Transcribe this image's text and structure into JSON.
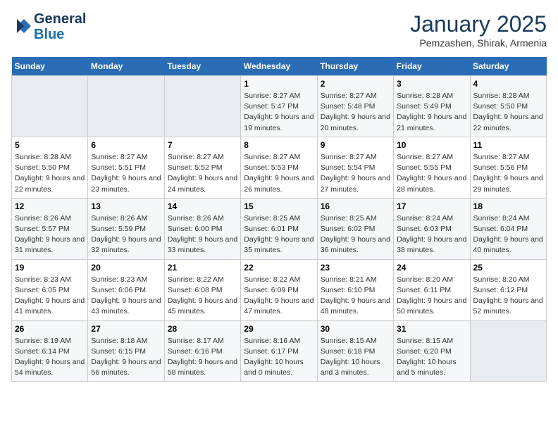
{
  "header": {
    "logo_line1": "General",
    "logo_line2": "Blue",
    "month": "January 2025",
    "location": "Pemzashen, Shirak, Armenia"
  },
  "weekdays": [
    "Sunday",
    "Monday",
    "Tuesday",
    "Wednesday",
    "Thursday",
    "Friday",
    "Saturday"
  ],
  "weeks": [
    [
      {
        "day": "",
        "empty": true
      },
      {
        "day": "",
        "empty": true
      },
      {
        "day": "",
        "empty": true
      },
      {
        "day": "1",
        "sunrise": "8:27 AM",
        "sunset": "5:47 PM",
        "daylight": "9 hours and 19 minutes."
      },
      {
        "day": "2",
        "sunrise": "8:27 AM",
        "sunset": "5:48 PM",
        "daylight": "9 hours and 20 minutes."
      },
      {
        "day": "3",
        "sunrise": "8:28 AM",
        "sunset": "5:49 PM",
        "daylight": "9 hours and 21 minutes."
      },
      {
        "day": "4",
        "sunrise": "8:28 AM",
        "sunset": "5:50 PM",
        "daylight": "9 hours and 22 minutes."
      }
    ],
    [
      {
        "day": "5",
        "sunrise": "8:28 AM",
        "sunset": "5:50 PM",
        "daylight": "9 hours and 22 minutes."
      },
      {
        "day": "6",
        "sunrise": "8:27 AM",
        "sunset": "5:51 PM",
        "daylight": "9 hours and 23 minutes."
      },
      {
        "day": "7",
        "sunrise": "8:27 AM",
        "sunset": "5:52 PM",
        "daylight": "9 hours and 24 minutes."
      },
      {
        "day": "8",
        "sunrise": "8:27 AM",
        "sunset": "5:53 PM",
        "daylight": "9 hours and 26 minutes."
      },
      {
        "day": "9",
        "sunrise": "8:27 AM",
        "sunset": "5:54 PM",
        "daylight": "9 hours and 27 minutes."
      },
      {
        "day": "10",
        "sunrise": "8:27 AM",
        "sunset": "5:55 PM",
        "daylight": "9 hours and 28 minutes."
      },
      {
        "day": "11",
        "sunrise": "8:27 AM",
        "sunset": "5:56 PM",
        "daylight": "9 hours and 29 minutes."
      }
    ],
    [
      {
        "day": "12",
        "sunrise": "8:26 AM",
        "sunset": "5:57 PM",
        "daylight": "9 hours and 31 minutes."
      },
      {
        "day": "13",
        "sunrise": "8:26 AM",
        "sunset": "5:59 PM",
        "daylight": "9 hours and 32 minutes."
      },
      {
        "day": "14",
        "sunrise": "8:26 AM",
        "sunset": "6:00 PM",
        "daylight": "9 hours and 33 minutes."
      },
      {
        "day": "15",
        "sunrise": "8:25 AM",
        "sunset": "6:01 PM",
        "daylight": "9 hours and 35 minutes."
      },
      {
        "day": "16",
        "sunrise": "8:25 AM",
        "sunset": "6:02 PM",
        "daylight": "9 hours and 36 minutes."
      },
      {
        "day": "17",
        "sunrise": "8:24 AM",
        "sunset": "6:03 PM",
        "daylight": "9 hours and 38 minutes."
      },
      {
        "day": "18",
        "sunrise": "8:24 AM",
        "sunset": "6:04 PM",
        "daylight": "9 hours and 40 minutes."
      }
    ],
    [
      {
        "day": "19",
        "sunrise": "8:23 AM",
        "sunset": "6:05 PM",
        "daylight": "9 hours and 41 minutes."
      },
      {
        "day": "20",
        "sunrise": "8:23 AM",
        "sunset": "6:06 PM",
        "daylight": "9 hours and 43 minutes."
      },
      {
        "day": "21",
        "sunrise": "8:22 AM",
        "sunset": "6:08 PM",
        "daylight": "9 hours and 45 minutes."
      },
      {
        "day": "22",
        "sunrise": "8:22 AM",
        "sunset": "6:09 PM",
        "daylight": "9 hours and 47 minutes."
      },
      {
        "day": "23",
        "sunrise": "8:21 AM",
        "sunset": "6:10 PM",
        "daylight": "9 hours and 48 minutes."
      },
      {
        "day": "24",
        "sunrise": "8:20 AM",
        "sunset": "6:11 PM",
        "daylight": "9 hours and 50 minutes."
      },
      {
        "day": "25",
        "sunrise": "8:20 AM",
        "sunset": "6:12 PM",
        "daylight": "9 hours and 52 minutes."
      }
    ],
    [
      {
        "day": "26",
        "sunrise": "8:19 AM",
        "sunset": "6:14 PM",
        "daylight": "9 hours and 54 minutes."
      },
      {
        "day": "27",
        "sunrise": "8:18 AM",
        "sunset": "6:15 PM",
        "daylight": "9 hours and 56 minutes."
      },
      {
        "day": "28",
        "sunrise": "8:17 AM",
        "sunset": "6:16 PM",
        "daylight": "9 hours and 58 minutes."
      },
      {
        "day": "29",
        "sunrise": "8:16 AM",
        "sunset": "6:17 PM",
        "daylight": "10 hours and 0 minutes."
      },
      {
        "day": "30",
        "sunrise": "8:15 AM",
        "sunset": "6:18 PM",
        "daylight": "10 hours and 3 minutes."
      },
      {
        "day": "31",
        "sunrise": "8:15 AM",
        "sunset": "6:20 PM",
        "daylight": "10 hours and 5 minutes."
      },
      {
        "day": "",
        "empty": true
      }
    ]
  ]
}
